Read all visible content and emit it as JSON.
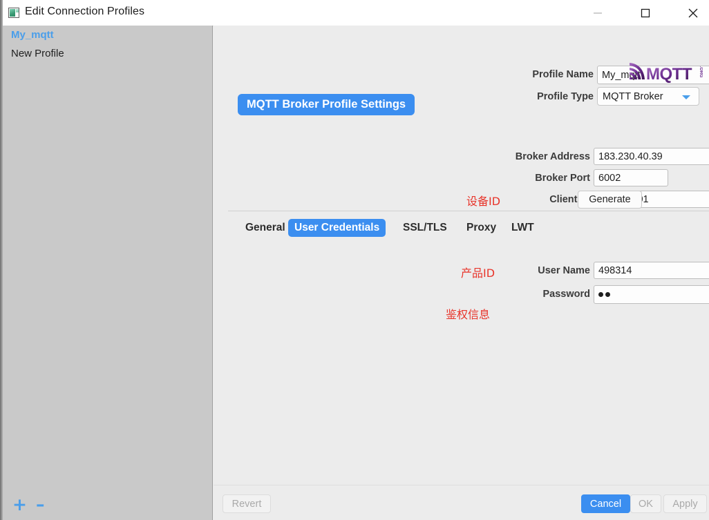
{
  "window": {
    "title": "Edit Connection Profiles",
    "icon": "app-window-icon",
    "controls": {
      "minimize": "—",
      "maximize": "□",
      "close": "✕"
    }
  },
  "sidebar": {
    "items": [
      {
        "label": "My_mqtt",
        "selected": true
      },
      {
        "label": "New Profile",
        "selected": false
      }
    ],
    "add_label": "+",
    "remove_label": "–"
  },
  "form": {
    "profile_name": {
      "label": "Profile Name",
      "value": "My_mqtt",
      "placeholder": "Profile Name"
    },
    "profile_type": {
      "label": "Profile Type",
      "value": "MQTT Broker",
      "options": [
        "MQTT Broker"
      ]
    },
    "settings_header": "MQTT Broker Profile Settings",
    "logo": {
      "name": "mqtt-org-logo",
      "wordmark": "MQTT",
      "suffix": ".ORG"
    },
    "broker_address": {
      "label": "Broker Address",
      "value": "183.230.40.39",
      "placeholder": "Broker Address"
    },
    "broker_port": {
      "label": "Broker Port",
      "value": "6002",
      "placeholder": "Port"
    },
    "client_id": {
      "label": "Client ID",
      "value": "913700301",
      "placeholder": "Client ID",
      "generate_label": "Generate"
    },
    "annotations": {
      "device_id": "设备ID",
      "product_id": "产品ID",
      "auth_info": "鉴权信息"
    }
  },
  "tabs": [
    {
      "label": "General",
      "active": false
    },
    {
      "label": "User Credentials",
      "active": true
    },
    {
      "label": "SSL/TLS",
      "active": false
    },
    {
      "label": "Proxy",
      "active": false
    },
    {
      "label": "LWT",
      "active": false
    }
  ],
  "credentials": {
    "user_name": {
      "label": "User Name",
      "value": "498314",
      "placeholder": "User Name"
    },
    "password": {
      "label": "Password",
      "value": "●●",
      "masked_length": 2,
      "placeholder": "Password"
    }
  },
  "footer": {
    "revert": {
      "label": "Revert",
      "enabled": false
    },
    "cancel": {
      "label": "Cancel",
      "enabled": true
    },
    "ok": {
      "label": "OK",
      "enabled": false
    },
    "apply": {
      "label": "Apply",
      "enabled": false
    }
  },
  "colors": {
    "accent": "#3b8ef0",
    "selected_item": "#4a9eea",
    "annotation": "#e8342a",
    "sidebar_bg": "#c9c9c9",
    "panel_bg": "#ececec",
    "titlebar_bg": "#ffffff",
    "logo_purple": "#6b2d8f"
  }
}
